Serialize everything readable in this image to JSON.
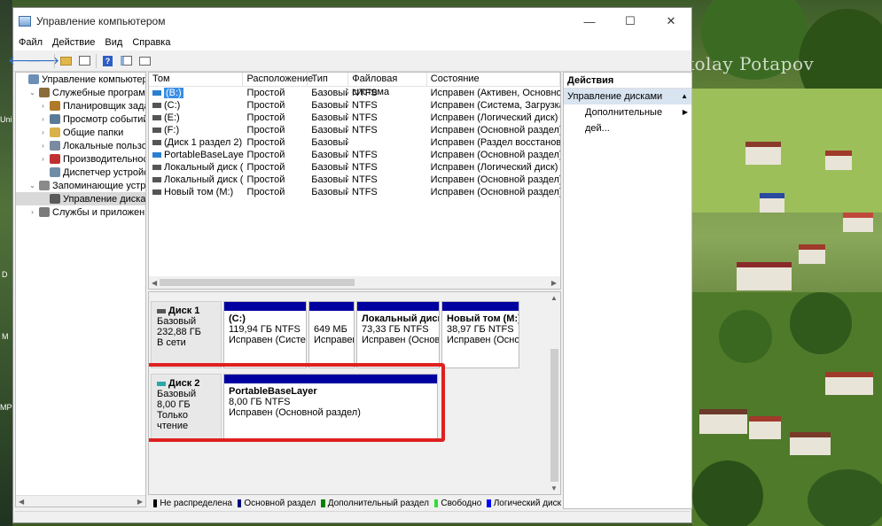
{
  "window": {
    "title": "Управление компьютером",
    "controls": {
      "minimize": "—",
      "maximize": "☐",
      "close": "✕"
    }
  },
  "watermark": "Nikolay Potapov",
  "menu": [
    "Файл",
    "Действие",
    "Вид",
    "Справка"
  ],
  "toolbar_icons": [
    "back-arrow-icon",
    "forward-arrow-icon",
    "folder-up-icon",
    "properties-icon",
    "help-icon",
    "console-tree-icon",
    "view-icon"
  ],
  "tree": [
    {
      "label": "Управление компьютером (л",
      "level": 0,
      "expander": "",
      "icon": "computer-icon",
      "color": "#6b8fb5"
    },
    {
      "label": "Служебные программы",
      "level": 1,
      "expander": "⌄",
      "icon": "tools-icon",
      "color": "#8a6d3b"
    },
    {
      "label": "Планировщик заданий",
      "level": 2,
      "expander": "›",
      "icon": "clock-icon",
      "color": "#b07a2a"
    },
    {
      "label": "Просмотр событий",
      "level": 2,
      "expander": "›",
      "icon": "event-viewer-icon",
      "color": "#5a7a9a"
    },
    {
      "label": "Общие папки",
      "level": 2,
      "expander": "›",
      "icon": "shared-folder-icon",
      "color": "#d8b14a"
    },
    {
      "label": "Локальные пользовате",
      "level": 2,
      "expander": "›",
      "icon": "users-icon",
      "color": "#7a8aa0"
    },
    {
      "label": "Производительность",
      "level": 2,
      "expander": "›",
      "icon": "performance-icon",
      "color": "#c03030"
    },
    {
      "label": "Диспетчер устройств",
      "level": 2,
      "expander": "",
      "icon": "device-manager-icon",
      "color": "#6f8ca8"
    },
    {
      "label": "Запоминающие устройст",
      "level": 1,
      "expander": "⌄",
      "icon": "storage-icon",
      "color": "#8a8a8a"
    },
    {
      "label": "Управление дисками",
      "level": 2,
      "expander": "",
      "icon": "disk-management-icon",
      "color": "#5a5a5a",
      "selected": true
    },
    {
      "label": "Службы и приложения",
      "level": 1,
      "expander": "›",
      "icon": "services-icon",
      "color": "#7a7a7a"
    }
  ],
  "volumes": {
    "headers": [
      "Том",
      "Расположение",
      "Тип",
      "Файловая система",
      "Состояние"
    ],
    "rows": [
      [
        "(B:)",
        "Простой",
        "Базовый",
        "NTFS",
        "Исправен (Активен, Основной ра"
      ],
      [
        "(C:)",
        "Простой",
        "Базовый",
        "NTFS",
        "Исправен (Система, Загрузка, Фа"
      ],
      [
        "(E:)",
        "Простой",
        "Базовый",
        "NTFS",
        "Исправен (Логический диск)"
      ],
      [
        "(F:)",
        "Простой",
        "Базовый",
        "NTFS",
        "Исправен (Основной раздел)"
      ],
      [
        "(Диск 1 раздел 2)",
        "Простой",
        "Базовый",
        "",
        "Исправен (Раздел восстановлени"
      ],
      [
        "PortableBaseLayer",
        "Простой",
        "Базовый",
        "NTFS",
        "Исправен (Основной раздел)"
      ],
      [
        "Локальный диск (D:)",
        "Простой",
        "Базовый",
        "NTFS",
        "Исправен (Логический диск)"
      ],
      [
        "Локальный диск (S:)",
        "Простой",
        "Базовый",
        "NTFS",
        "Исправен (Основной раздел)"
      ],
      [
        "Новый том (M:)",
        "Простой",
        "Базовый",
        "NTFS",
        "Исправен (Основной раздел)"
      ]
    ]
  },
  "disks": [
    {
      "name": "Диск 1",
      "type": "Базовый",
      "size": "232,88 ГБ",
      "status": "В сети",
      "partitions": [
        {
          "title": "(C:)",
          "line2": "119,94 ГБ NTFS",
          "line3": "Исправен (Система,"
        },
        {
          "title": "",
          "line2": "649 МБ",
          "line3": "Исправен"
        },
        {
          "title": "Локальный диск",
          "line2": "73,33 ГБ NTFS",
          "line3": "Исправен (Основно"
        },
        {
          "title": "Новый том (M:)",
          "line2": "38,97 ГБ NTFS",
          "line3": "Исправен (Основ"
        }
      ]
    },
    {
      "name": "Диск 2",
      "type": "Базовый",
      "size": "8,00 ГБ",
      "status": "Только чтение",
      "partitions": [
        {
          "title": "PortableBaseLayer",
          "line2": "8,00 ГБ NTFS",
          "line3": "Исправен (Основной раздел)"
        }
      ]
    }
  ],
  "legend": [
    {
      "label": "Не распределена",
      "color": "#000000"
    },
    {
      "label": "Основной раздел",
      "color": "#000080"
    },
    {
      "label": "Дополнительный раздел",
      "color": "#008000"
    },
    {
      "label": "Свободно",
      "color": "#33dd33"
    },
    {
      "label": "Логический диск",
      "color": "#0000ff"
    }
  ],
  "actions": {
    "header": "Действия",
    "section": "Управление дисками",
    "item": "Дополнительные дей..."
  },
  "desktop_left_labels": [
    "Uni",
    "D",
    "M",
    "MP"
  ]
}
